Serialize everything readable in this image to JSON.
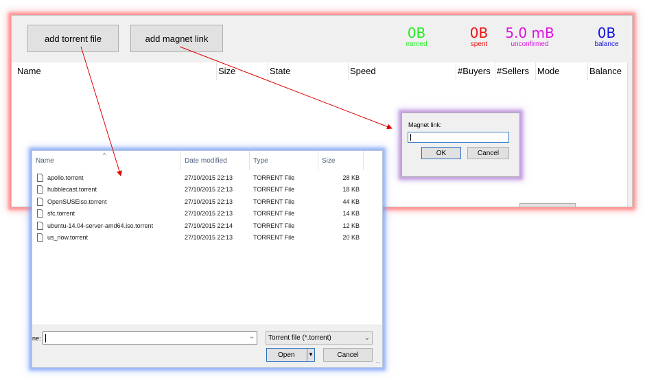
{
  "toolbar": {
    "add_torrent_label": "add torrent file",
    "add_magnet_label": "add magnet link"
  },
  "stats": [
    {
      "value": "0B",
      "label": "earned",
      "color": "#22ee22"
    },
    {
      "value": "0B",
      "label": "spent",
      "color": "#ee1111"
    },
    {
      "value": "5.0 mB",
      "label": "unconfirmed",
      "color": "#dd11dd"
    },
    {
      "value": "0B",
      "label": "balance",
      "color": "#1111dd"
    }
  ],
  "columns": [
    "Name",
    "Size",
    "State",
    "Speed",
    "#Buyers",
    "#Sellers",
    "Mode",
    "Balance"
  ],
  "magnet_dialog": {
    "label": "Magnet link:",
    "value": "",
    "ok_label": "OK",
    "cancel_label": "Cancel"
  },
  "file_dialog": {
    "columns": [
      "Name",
      "Date modified",
      "Type",
      "Size"
    ],
    "files": [
      {
        "name": "apollo.torrent",
        "date": "27/10/2015 22:13",
        "type": "TORRENT File",
        "size": "28 KB"
      },
      {
        "name": "hubblecast.torrent",
        "date": "27/10/2015 22:13",
        "type": "TORRENT File",
        "size": "18 KB"
      },
      {
        "name": "OpenSUSEiso.torrent",
        "date": "27/10/2015 22:13",
        "type": "TORRENT File",
        "size": "44 KB"
      },
      {
        "name": "sfc.torrent",
        "date": "27/10/2015 22:13",
        "type": "TORRENT File",
        "size": "14 KB"
      },
      {
        "name": "ubuntu-14.04-server-amd64.iso.torrent",
        "date": "27/10/2015 22:14",
        "type": "TORRENT File",
        "size": "12 KB"
      },
      {
        "name": "us_now.torrent",
        "date": "27/10/2015 22:13",
        "type": "TORRENT File",
        "size": "20 KB"
      }
    ],
    "filename_label": "ne:",
    "filename_value": "",
    "filter_value": "Torrent file (*.torrent)",
    "open_label": "Open",
    "cancel_label": "Cancel"
  },
  "annotation_color": "#dd0000"
}
